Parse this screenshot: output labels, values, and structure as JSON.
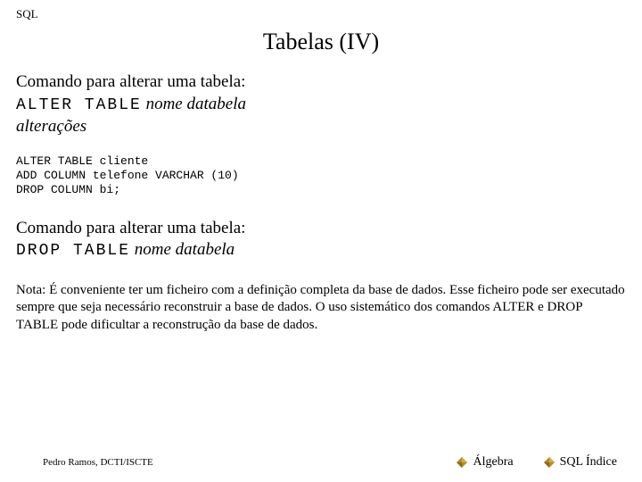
{
  "header": {
    "label": "SQL"
  },
  "title": "Tabelas (IV)",
  "section1": {
    "intro": "Comando para alterar uma tabela:",
    "cmd": "ALTER TABLE",
    "arg": "nome databela",
    "line3": "alterações"
  },
  "code": {
    "l1": "ALTER TABLE cliente",
    "l2": "ADD COLUMN telefone VARCHAR (10)",
    "l3": "DROP COLUMN bi;"
  },
  "section2": {
    "intro": "Comando para alterar uma tabela:",
    "cmd": "DROP TABLE",
    "arg": "nome databela"
  },
  "note": "Nota: É conveniente ter um ficheiro com a definição completa da base de dados. Esse ficheiro pode ser executado sempre que seja necessário reconstruir a base de dados. O uso sistemático dos comandos ALTER e DROP TABLE pode dificultar a reconstrução da base de dados.",
  "footer": {
    "author": "Pedro Ramos, DCTI/ISCTE",
    "link1": "Álgebra",
    "link2": "SQL Índice"
  },
  "colors": {
    "diamond": "#b58a2a"
  }
}
